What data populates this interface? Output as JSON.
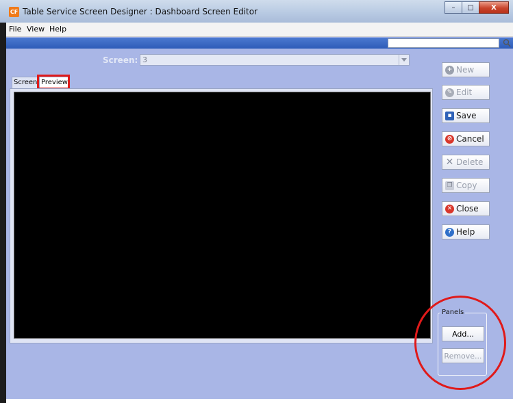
{
  "window": {
    "title": "Table Service Screen Designer : Dashboard Screen Editor",
    "icon_text": "CF",
    "controls": {
      "minimize": "–",
      "maximize": "□",
      "close": "X"
    }
  },
  "menu": {
    "items": [
      "File",
      "View",
      "Help"
    ]
  },
  "screen": {
    "label": "Screen:",
    "value": "3"
  },
  "tabs": [
    "Screen",
    "Preview"
  ],
  "buttons": {
    "new": "New",
    "edit": "Edit",
    "save": "Save",
    "cancel": "Cancel",
    "delete": "Delete",
    "copy": "Copy",
    "close": "Close",
    "help": "Help"
  },
  "panels": {
    "label": "Panels",
    "add": "Add...",
    "remove": "Remove..."
  },
  "colors": {
    "accent_bar": "#2e5cb8",
    "window_bg": "#a9b6e6",
    "highlight": "#e01a1a"
  }
}
